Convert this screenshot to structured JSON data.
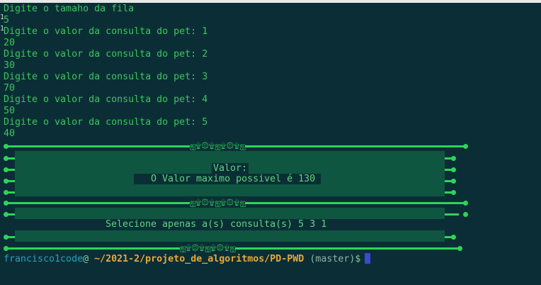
{
  "terminal": {
    "lines": [
      "Digite o tamaho da fila",
      "5",
      "Digite o valor da consulta do pet: 1",
      "20",
      "Digite o valor da consulta do pet: 2",
      "30",
      "Digite o valor da consulta do pet: 3",
      "70",
      "Digite o valor da consulta do pet: 4",
      "50",
      "Digite o valor da consulta do pet: 5",
      "40"
    ]
  },
  "gutter": {
    "marks": [
      "1",
      "1"
    ]
  },
  "panel1": {
    "valor_label": "Valor:",
    "max_value_text": "O Valor maximo possivel é 130"
  },
  "panel2": {
    "selection_text": "Selecione apenas a(s) consulta(s) 5 3 1"
  },
  "ornament": "ஐ۩۞۩ஐ۩۞۩ஐ",
  "prompt": {
    "user": "francisco1code",
    "at": "@",
    "path": "~/2021-2/projeto_de_algoritmos/PD-PWD",
    "branch": "(master)",
    "symbol": "$"
  },
  "colors": {
    "background": "#0b2e36",
    "text_green": "#3cc65a",
    "panel_green": "#0f5640",
    "accent_line": "#2fd35a",
    "prompt_user": "#27a0b8",
    "prompt_path": "#e7a937",
    "cursor": "#3a49d6"
  }
}
